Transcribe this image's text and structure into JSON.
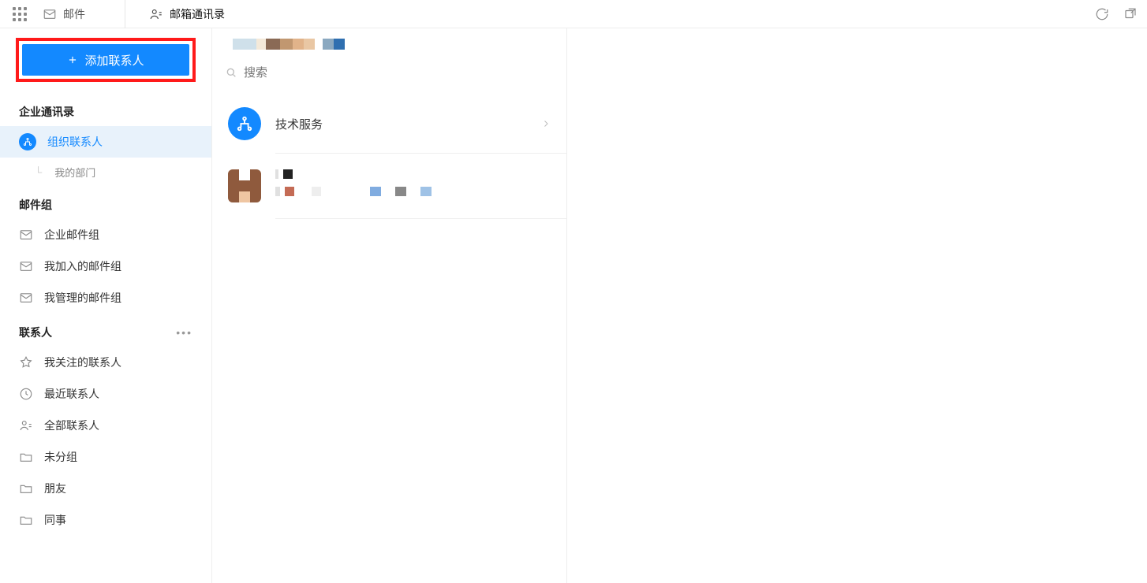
{
  "topbar": {
    "mail_label": "邮件",
    "contacts_label": "邮箱通讯录"
  },
  "add_contact_label": "添加联系人",
  "sections": {
    "enterprise": {
      "title": "企业通讯录",
      "org_contacts_label": "组织联系人",
      "my_dept_label": "我的部门"
    },
    "mailgroups": {
      "title": "邮件组",
      "items": [
        {
          "label": "企业邮件组"
        },
        {
          "label": "我加入的邮件组"
        },
        {
          "label": "我管理的邮件组"
        }
      ]
    },
    "contacts": {
      "title": "联系人",
      "items": [
        {
          "label": "我关注的联系人",
          "icon": "star"
        },
        {
          "label": "最近联系人",
          "icon": "clock"
        },
        {
          "label": "全部联系人",
          "icon": "person"
        },
        {
          "label": "未分组",
          "icon": "folder"
        },
        {
          "label": "朋友",
          "icon": "folder"
        },
        {
          "label": "同事",
          "icon": "folder"
        }
      ]
    }
  },
  "search_placeholder": "搜索",
  "department_name": "技术服务"
}
